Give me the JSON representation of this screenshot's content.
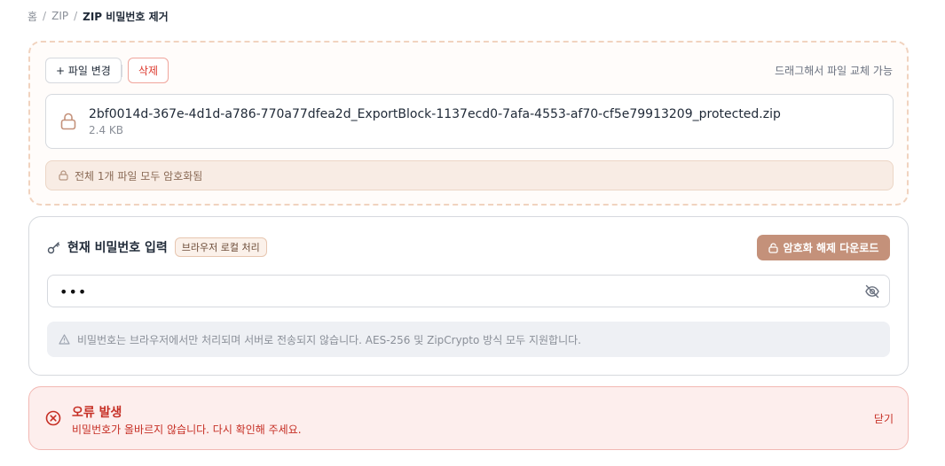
{
  "breadcrumb": {
    "home": "홈",
    "zip": "ZIP",
    "current": "ZIP 비밀번호 제거",
    "separator": "/"
  },
  "file_panel": {
    "change_button": "+ 파일 변경",
    "delete_button": "삭제",
    "drag_hint": "드래그해서 파일 교체 가능",
    "file": {
      "name": "2bf0014d-367e-4d1d-a786-770a77dfea2d_ExportBlock-1137ecd0-7afa-4553-af70-cf5e79913209_protected.zip",
      "size": "2.4 KB",
      "icon": "lock-icon"
    },
    "status": "전체 1개 파일 모두 암호화됨"
  },
  "password_panel": {
    "title": "현재 비밀번호 입력",
    "badge": "브라우저 로컬 처리",
    "decrypt_button": "암호화 해제 다운로드",
    "input_value": "•••",
    "note": "비밀번호는 브라우저에서만 처리되며 서버로 전송되지 않습니다. AES-256 및 ZipCrypto 방식 모두 지원합니다."
  },
  "error": {
    "title": "오류 발생",
    "message": "비밀번호가 올바르지 않습니다. 다시 확인해 주세요.",
    "close": "닫기"
  },
  "colors": {
    "accent": "#c4917a",
    "error": "#c62f25",
    "dashed_border": "#f1d3bf"
  }
}
